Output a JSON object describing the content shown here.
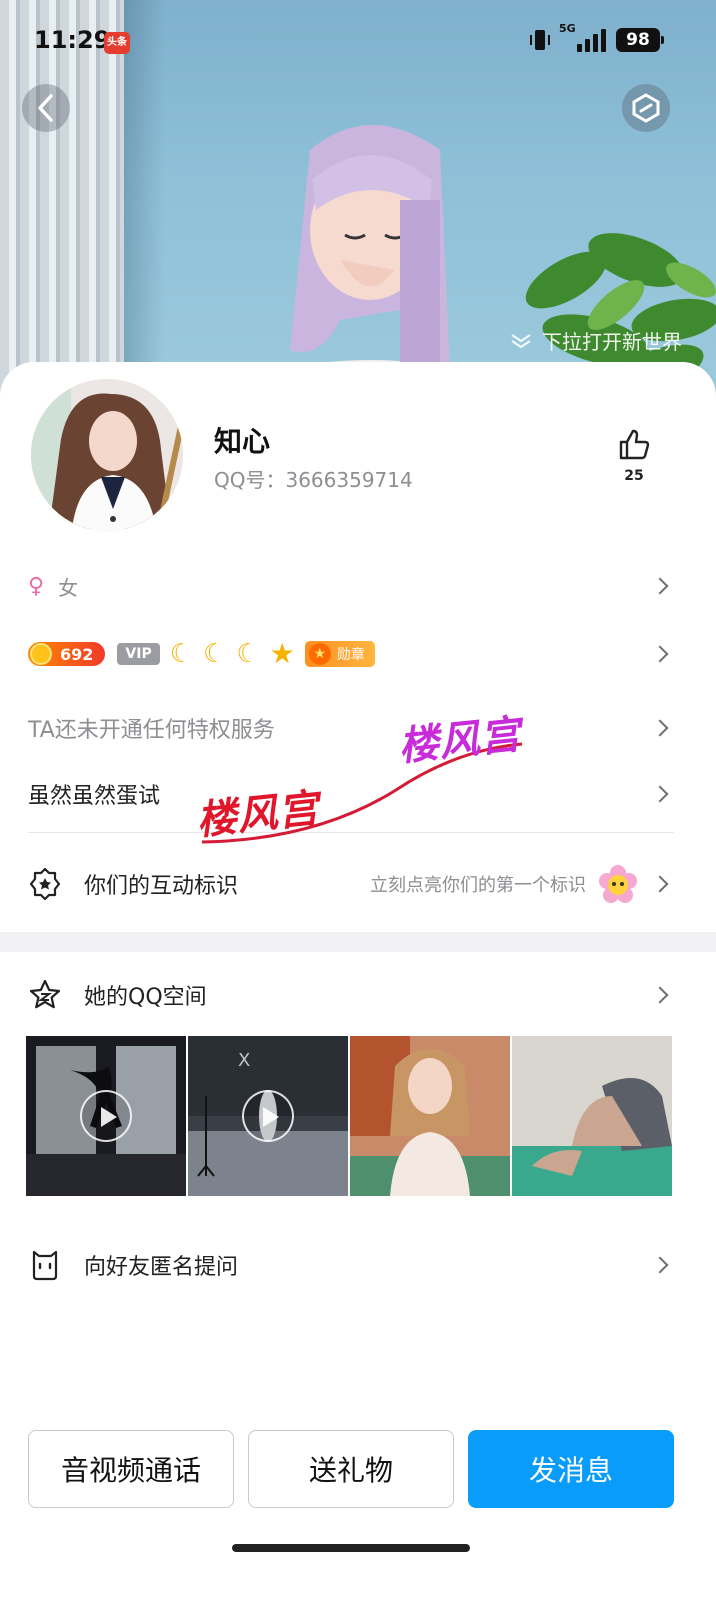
{
  "status_bar": {
    "time": "11:29",
    "app_badge": "头条",
    "network": "5G",
    "battery": "98"
  },
  "hero": {
    "pull_hint": "下拉打开新世界"
  },
  "profile": {
    "nickname": "知心",
    "qq_label": "QQ号：",
    "qq_number": "3666359714",
    "likes": "25",
    "gender": "女",
    "level_points": "692",
    "vip_label": "VIP",
    "medal_label": "勋章",
    "privilege_text": "TA还未开通任何特权服务",
    "signature": "虽然虽然蛋试"
  },
  "interaction": {
    "label": "你们的互动标识",
    "hint": "立刻点亮你们的第一个标识"
  },
  "qzone": {
    "label": "她的QQ空间"
  },
  "ask": {
    "label": "向好友匿名提问"
  },
  "watermark": {
    "text": "楼风宫"
  },
  "actions": {
    "call": "音视频通话",
    "gift": "送礼物",
    "message": "发消息"
  },
  "colors": {
    "primary": "#0a9cfb",
    "gender_female": "#f06aa7",
    "watermark_red": "#e0162b",
    "watermark_purple": "#c82bd9"
  }
}
